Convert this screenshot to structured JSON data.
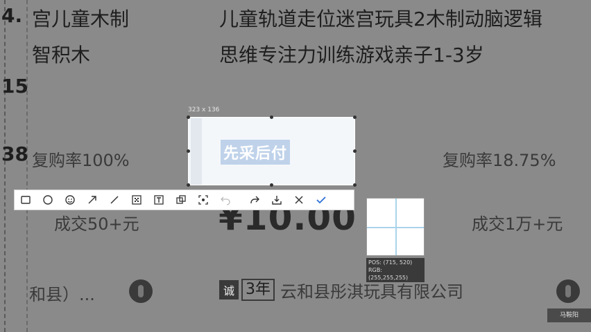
{
  "left_column": {
    "index_label": "4.",
    "title_line1": "宫儿童木制",
    "title_line2": "智积木",
    "num_a": "15",
    "num_b": "38",
    "repurchase": "复购率100%",
    "deals": "成交50+元",
    "location": "和县）..."
  },
  "right_column": {
    "title_line1": "儿童轨道走位迷宫玩具2木制动脑逻辑",
    "title_line2": "思维专注力训练游戏亲子1-3岁",
    "repurchase": "复购率18.75%",
    "deals": "成交1万+元",
    "price": "¥10.00",
    "shop_icon": "诚",
    "shop_years": "3年",
    "shop_name": "云和县彤淇玩具有限公司"
  },
  "capture": {
    "size_label": "323 x 136",
    "selected_text": "先采后付",
    "pos_label": "POS: (715, 520)",
    "rgb_label": "RGB: (255,255,255)"
  },
  "toolbar": {
    "tools": [
      "rectangle-icon",
      "ellipse-icon",
      "emoji-icon",
      "arrow-icon",
      "line-icon",
      "mosaic-icon",
      "text-icon",
      "copy-icon",
      "pin-icon",
      "undo-icon",
      "share-icon",
      "save-icon",
      "close-icon",
      "confirm-icon"
    ]
  },
  "corner_button": "马鞍阳"
}
